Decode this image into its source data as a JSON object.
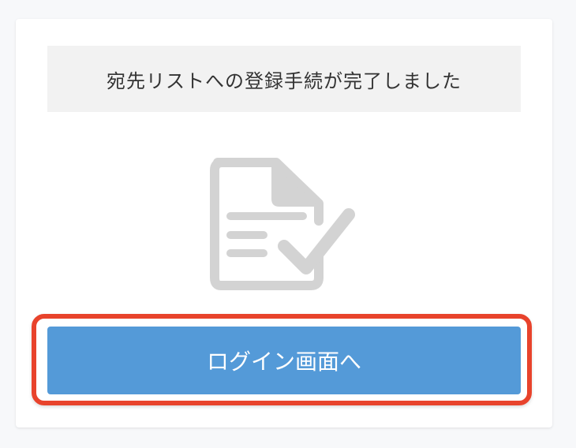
{
  "message": {
    "text": "宛先リストへの登録手続が完了しました"
  },
  "icon": {
    "name": "document-check-icon",
    "color": "#d3d3d3"
  },
  "login_button": {
    "label": "ログイン画面へ",
    "background": "#549ad8",
    "highlight_color": "#e8432c"
  }
}
